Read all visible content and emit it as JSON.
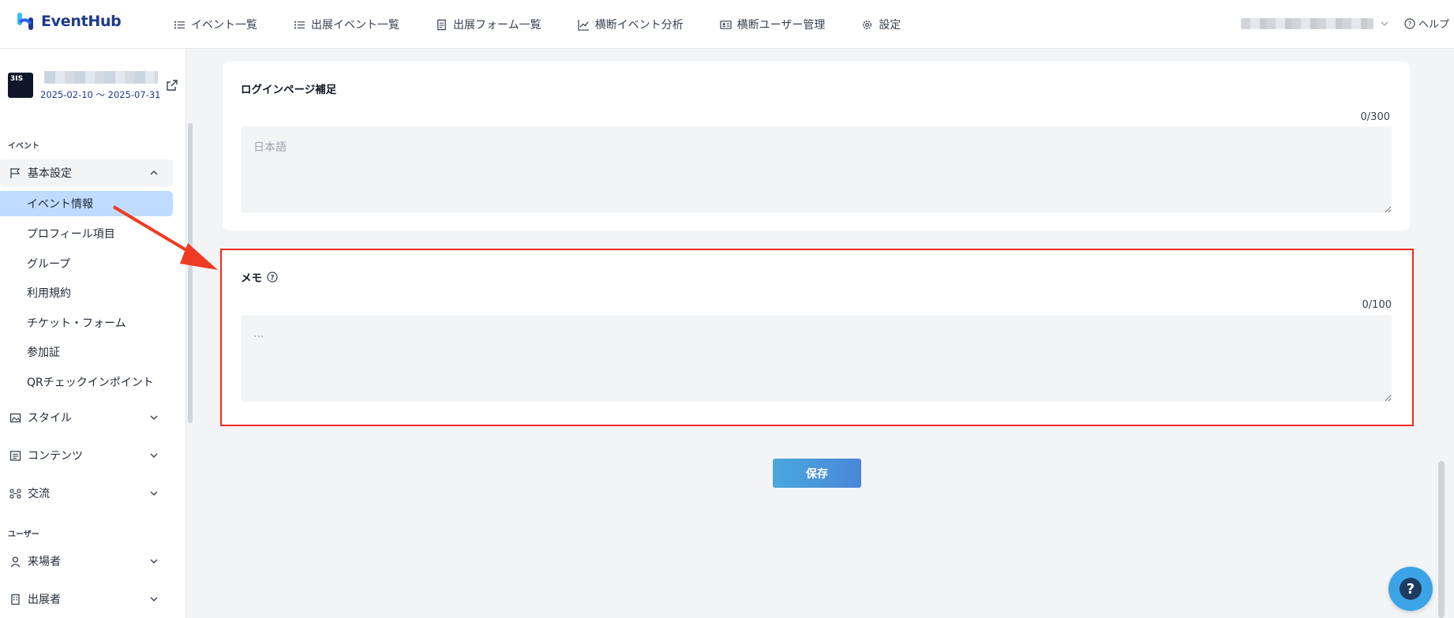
{
  "app": {
    "name": "EventHub"
  },
  "nav": {
    "items": [
      {
        "label": "イベント一覧",
        "icon": "list-icon"
      },
      {
        "label": "出展イベント一覧",
        "icon": "list-icon"
      },
      {
        "label": "出展フォーム一覧",
        "icon": "form-icon"
      },
      {
        "label": "横断イベント分析",
        "icon": "chart-icon"
      },
      {
        "label": "横断ユーザー管理",
        "icon": "id-card-icon"
      },
      {
        "label": "設定",
        "icon": "gear-icon"
      }
    ],
    "help_label": "ヘルプ"
  },
  "event": {
    "date_range": "2025-02-10 ～ 2025-07-31",
    "thumb_text": "3IS"
  },
  "sidebar": {
    "section_event": "イベント",
    "section_user": "ユーザー",
    "basic_settings": {
      "label": "基本設定",
      "items": [
        {
          "label": "イベント情報",
          "active": true
        },
        {
          "label": "プロフィール項目"
        },
        {
          "label": "グループ"
        },
        {
          "label": "利用規約"
        },
        {
          "label": "チケット・フォーム"
        },
        {
          "label": "参加証"
        },
        {
          "label": "QRチェックインポイント"
        }
      ]
    },
    "style": "スタイル",
    "contents": "コンテンツ",
    "exchange": "交流",
    "visitors": "来場者",
    "exhibitors": "出展者"
  },
  "login_supplement": {
    "title": "ログインページ補足",
    "counter": "0/300",
    "placeholder": "日本語"
  },
  "memo": {
    "title": "メモ",
    "counter": "0/100",
    "placeholder": "..."
  },
  "save_label": "保存",
  "colors": {
    "highlight": "#ef2a1a",
    "active_item": "#bfdbfe",
    "brand": "#1e3a8a",
    "button": "#4a9bdc"
  }
}
